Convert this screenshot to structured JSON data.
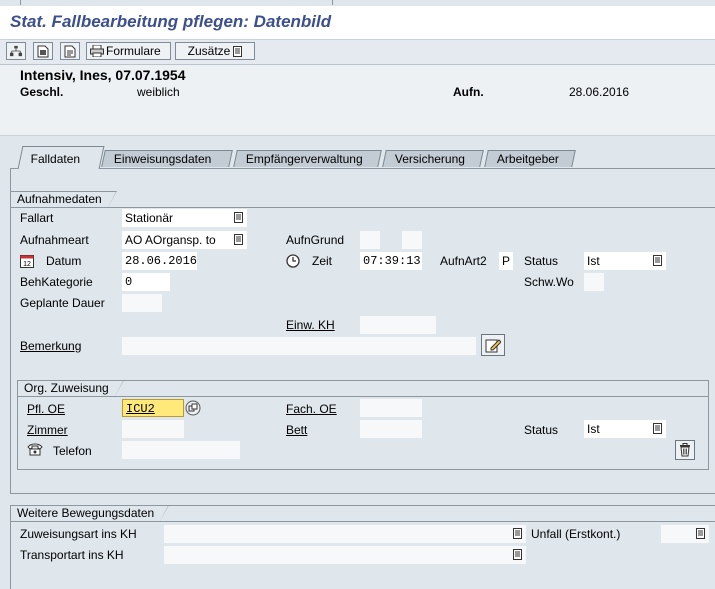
{
  "window": {
    "title": "Stat. Fallbearbeitung pflegen: Datenbild"
  },
  "toolbar": {
    "formulare_label": "Formulare",
    "zusaetze_label": "Zusätze"
  },
  "patient": {
    "name_line": "Intensiv, Ines, 07.07.1954",
    "gender_label": "Geschl.",
    "gender_value": "weiblich",
    "admission_label": "Aufn.",
    "admission_value": "28.06.2016"
  },
  "tabs": [
    {
      "label": "Falldaten",
      "active": true
    },
    {
      "label": "Einweisungsdaten"
    },
    {
      "label": "Empfängerverwaltung"
    },
    {
      "label": "Versicherung"
    },
    {
      "label": "Arbeitgeber"
    }
  ],
  "aufnahmedaten": {
    "title": "Aufnahmedaten",
    "fallart_label": "Fallart",
    "fallart_value": "Stationär",
    "aufnahmeart_label": "Aufnahmeart",
    "aufnahmeart_value": "AO AOrgansp. to",
    "aufngrund_label": "AufnGrund",
    "datum_label": "Datum",
    "datum_value": "28.06.2016",
    "zeit_label": "Zeit",
    "zeit_value": "07:39:13",
    "aufnart2_label": "AufnArt2",
    "aufnart2_value": "P",
    "status_label": "Status",
    "status_value": "Ist",
    "behkategorie_label": "BehKategorie",
    "behkategorie_value": "0",
    "schwwo_label": "Schw.Wo",
    "geplante_dauer_label": "Geplante Dauer",
    "einw_kh_label": "Einw. KH",
    "bemerkung_label": "Bemerkung"
  },
  "org_zuweisung": {
    "title": "Org. Zuweisung",
    "pfl_oe_label": "Pfl. OE",
    "pfl_oe_value": "ICU2",
    "fach_oe_label": "Fach. OE",
    "zimmer_label": "Zimmer",
    "bett_label": "Bett",
    "status_label": "Status",
    "status_value": "Ist",
    "telefon_label": "Telefon"
  },
  "weitere": {
    "title": "Weitere Bewegungsdaten",
    "zuweisungsart_label": "Zuweisungsart ins KH",
    "unfall_label": "Unfall (Erstkont.)",
    "transportart_label": "Transportart ins KH"
  },
  "colors": {
    "title_text": "#3c4f8f",
    "background": "#dfe6ec",
    "highlight_field": "#ffe97a"
  },
  "icons": [
    "hierarchy-icon",
    "document-icon",
    "document-print-icon",
    "printer-icon",
    "list-icon",
    "calendar-icon",
    "clock-icon",
    "edit-pencil-icon",
    "trash-icon",
    "telephone-icon",
    "dropdown-list-icon",
    "object-link-icon"
  ]
}
